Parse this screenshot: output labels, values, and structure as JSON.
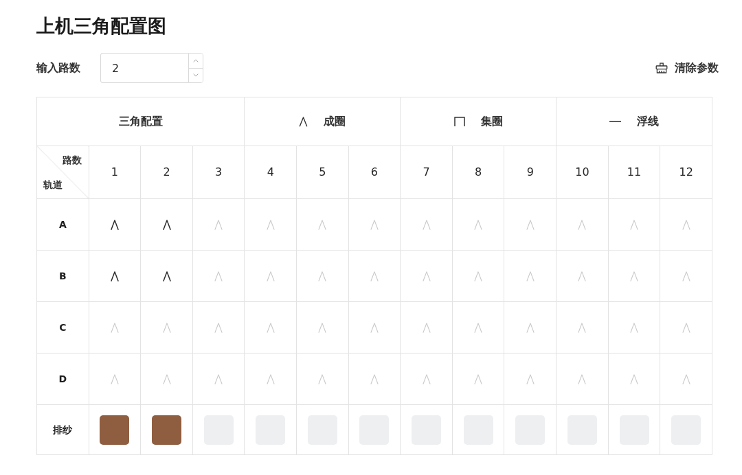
{
  "title": "上机三角配置图",
  "feed_input": {
    "label": "输入路数",
    "value": "2"
  },
  "clear_button": {
    "label": "清除参数"
  },
  "table": {
    "groups": [
      {
        "kind": "plain",
        "label": "三角配置"
      },
      {
        "kind": "knit",
        "label": "成圈"
      },
      {
        "kind": "tuck",
        "label": "集圈"
      },
      {
        "kind": "float",
        "label": "浮线"
      }
    ],
    "corner": {
      "column_label": "路数",
      "row_label": "轨道"
    },
    "columns": [
      "1",
      "2",
      "3",
      "4",
      "5",
      "6",
      "7",
      "8",
      "9",
      "10",
      "11",
      "12"
    ],
    "rows": [
      {
        "label": "A",
        "cells": [
          {
            "on": true
          },
          {
            "on": true
          },
          {
            "on": false
          },
          {
            "on": false
          },
          {
            "on": false
          },
          {
            "on": false
          },
          {
            "on": false
          },
          {
            "on": false
          },
          {
            "on": false
          },
          {
            "on": false
          },
          {
            "on": false
          },
          {
            "on": false
          }
        ]
      },
      {
        "label": "B",
        "cells": [
          {
            "on": true
          },
          {
            "on": true
          },
          {
            "on": false
          },
          {
            "on": false
          },
          {
            "on": false
          },
          {
            "on": false
          },
          {
            "on": false
          },
          {
            "on": false
          },
          {
            "on": false
          },
          {
            "on": false
          },
          {
            "on": false
          },
          {
            "on": false
          }
        ]
      },
      {
        "label": "C",
        "cells": [
          {
            "on": false
          },
          {
            "on": false
          },
          {
            "on": false
          },
          {
            "on": false
          },
          {
            "on": false
          },
          {
            "on": false
          },
          {
            "on": false
          },
          {
            "on": false
          },
          {
            "on": false
          },
          {
            "on": false
          },
          {
            "on": false
          },
          {
            "on": false
          }
        ]
      },
      {
        "label": "D",
        "cells": [
          {
            "on": false
          },
          {
            "on": false
          },
          {
            "on": false
          },
          {
            "on": false
          },
          {
            "on": false
          },
          {
            "on": false
          },
          {
            "on": false
          },
          {
            "on": false
          },
          {
            "on": false
          },
          {
            "on": false
          },
          {
            "on": false
          },
          {
            "on": false
          }
        ]
      }
    ],
    "yarn_row": {
      "label": "排纱",
      "swatches": [
        {
          "color": "#8f5e40"
        },
        {
          "color": "#8f5e40"
        },
        {
          "color": "#eeeff1"
        },
        {
          "color": "#eeeff1"
        },
        {
          "color": "#eeeff1"
        },
        {
          "color": "#eeeff1"
        },
        {
          "color": "#eeeff1"
        },
        {
          "color": "#eeeff1"
        },
        {
          "color": "#eeeff1"
        },
        {
          "color": "#eeeff1"
        },
        {
          "color": "#eeeff1"
        },
        {
          "color": "#eeeff1"
        }
      ]
    }
  }
}
